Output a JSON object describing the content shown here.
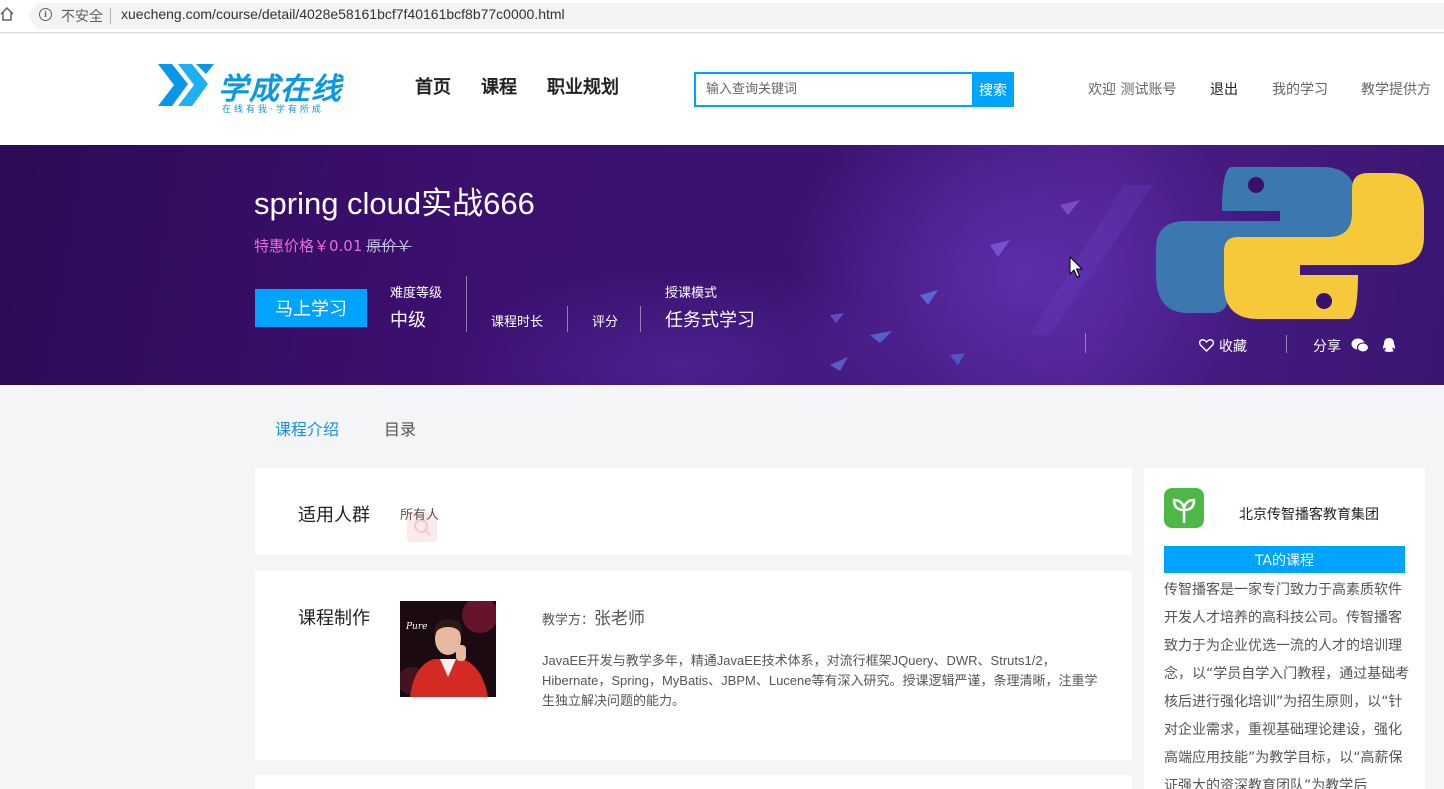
{
  "browser": {
    "security_label": "不安全",
    "url": "xuecheng.com/course/detail/4028e58161bcf7f40161bcf8b77c0000.html"
  },
  "header": {
    "logo_text": "学成在线",
    "logo_slogan": "在线有我·学有所成",
    "nav": [
      "首页",
      "课程",
      "职业规划"
    ],
    "search_placeholder": "输入查询关键词",
    "search_button": "搜索",
    "welcome": "欢迎 测试账号",
    "logout": "退出",
    "my_learning": "我的学习",
    "teaching_provider": "教学提供方"
  },
  "course": {
    "title": "spring cloud实战666",
    "special_price": "特惠价格￥0.01",
    "original_price": "原价￥",
    "learn_button": "马上学习",
    "difficulty_label": "难度等级",
    "difficulty_value": "中级",
    "duration_label": "课程时长",
    "rating_label": "评分",
    "mode_label": "授课模式",
    "mode_value": "任务式学习",
    "favorite": "收藏",
    "share": "分享"
  },
  "tabs": [
    "课程介绍",
    "目录"
  ],
  "audience": {
    "title": "适用人群",
    "value": "所有人"
  },
  "production": {
    "title": "课程制作",
    "teacher_prefix": "教学方：",
    "teacher_name": "张老师",
    "description": "JavaEE开发与教学多年，精通JavaEE技术体系，对流行框架JQuery、DWR、Struts1/2，Hibernate，Spring，MyBatis、JBPM、Lucene等有深入研究。授课逻辑严谨，条理清晰，注重学生独立解决问题的能力。"
  },
  "org": {
    "name": "北京传智播客教育集团",
    "courses_button": "TA的课程",
    "description": "传智播客是一家专门致力于高素质软件开发人才培养的高科技公司。传智播客致力于为企业优选一流的人才的培训理念，以“学员自学入门教程，通过基础考核后进行强化培训”为招生原则，以“针对企业需求，重视基础理论建设，强化高端应用技能”为教学目标，以“高薪保证强大的资深教育团队”为教学后"
  },
  "colors": {
    "accent": "#00a4ff",
    "price": "#ea6ad9",
    "banner": "#3b0f6e"
  }
}
